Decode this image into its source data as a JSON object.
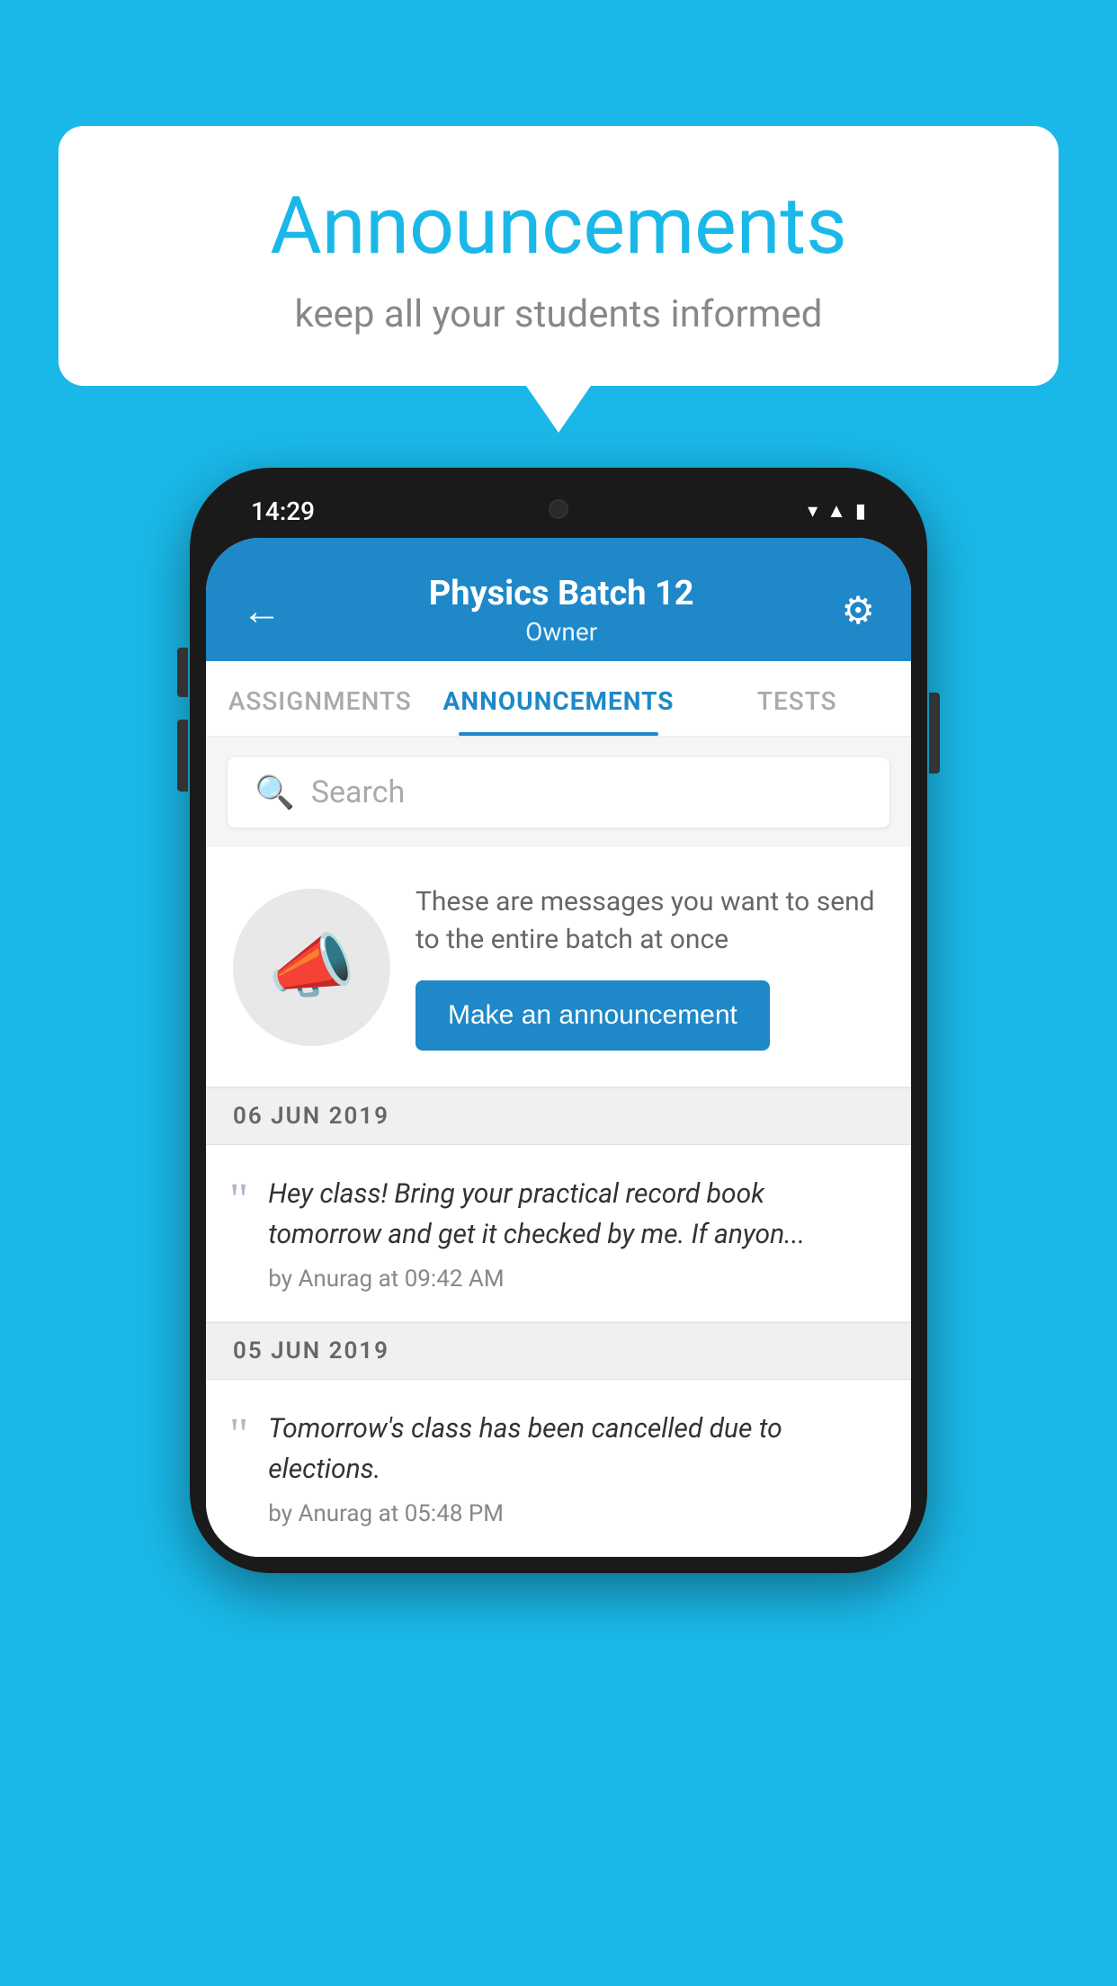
{
  "background_color": "#1ab8e8",
  "speech_bubble": {
    "title": "Announcements",
    "subtitle": "keep all your students informed"
  },
  "phone": {
    "status_bar": {
      "time": "14:29",
      "icons": [
        "wifi",
        "signal",
        "battery"
      ]
    },
    "header": {
      "back_label": "←",
      "title": "Physics Batch 12",
      "subtitle": "Owner",
      "settings_label": "⚙"
    },
    "tabs": [
      {
        "label": "ASSIGNMENTS",
        "active": false
      },
      {
        "label": "ANNOUNCEMENTS",
        "active": true
      },
      {
        "label": "TESTS",
        "active": false
      }
    ],
    "search": {
      "placeholder": "Search"
    },
    "promo": {
      "description": "These are messages you want to send to the entire batch at once",
      "button_label": "Make an announcement"
    },
    "announcements": [
      {
        "date": "06  JUN  2019",
        "text": "Hey class! Bring your practical record book tomorrow and get it checked by me. If anyon...",
        "meta": "by Anurag at 09:42 AM"
      },
      {
        "date": "05  JUN  2019",
        "text": "Tomorrow's class has been cancelled due to elections.",
        "meta": "by Anurag at 05:48 PM"
      }
    ]
  }
}
